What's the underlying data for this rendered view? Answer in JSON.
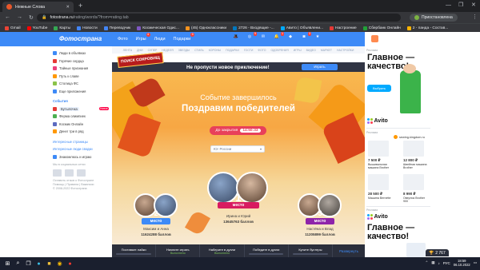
{
  "browser": {
    "tab_title": "Нежные Слова",
    "url_host": "fotostrana.ru",
    "url_path": "/rating/words/?from=rating.tab",
    "incognito_label": "Приостановлена"
  },
  "bookmarks": [
    {
      "label": "Gmail",
      "color": "#ea4335"
    },
    {
      "label": "YouTube",
      "color": "#ff0000"
    },
    {
      "label": "Карты",
      "color": "#34a853"
    },
    {
      "label": "Новости",
      "color": "#4285f4"
    },
    {
      "label": "Переводчик",
      "color": "#4285f4"
    },
    {
      "label": "Космическая Одис...",
      "color": "#7e57c2"
    },
    {
      "label": "(45) Одноклассники",
      "color": "#f7931e"
    },
    {
      "label": "2726 - Входящие -...",
      "color": "#0277bd"
    },
    {
      "label": "Авито | Объявлени...",
      "color": "#00aaff"
    },
    {
      "label": "Настроение",
      "color": "#e53935"
    },
    {
      "label": "Сбербанк Онлайн",
      "color": "#21a038"
    },
    {
      "label": "2 - панда - Состав...",
      "color": "#ffb300"
    }
  ],
  "site": {
    "logo": "Фотострана",
    "nav": [
      {
        "label": "Фото",
        "badge": ""
      },
      {
        "label": "Игры",
        "badge": "4"
      },
      {
        "label": "Люди",
        "badge": ""
      },
      {
        "label": "Подарки",
        "badge": "5"
      }
    ],
    "header_icons": [
      {
        "icon": "hat-icon",
        "badge": ""
      },
      {
        "icon": "coins-icon",
        "badge": "5"
      },
      {
        "icon": "chat-icon",
        "badge": ""
      },
      {
        "icon": "bell-icon",
        "badge": "1"
      },
      {
        "icon": "diamond-icon",
        "badge": ""
      },
      {
        "icon": "camera-icon",
        "badge": "3"
      },
      {
        "icon": "star-icon",
        "badge": ""
      }
    ],
    "user_name": "Юрий",
    "subnav": [
      "ЛЕНТА",
      "ДНИ",
      "СУПЕР",
      "НЕДЕЛЯ",
      "ЗВЕЗДЫ",
      "СТИЛЬ",
      "КОРОНЫ",
      "ПОДАРКИ",
      "ГОСТИ",
      "ФОТО",
      "ОДОБРЕНИЯ",
      "ИГРЫ",
      "ВИДЕО",
      "МАРКЕТ",
      "НАСТРОЙКИ"
    ]
  },
  "sidebar": {
    "items": [
      {
        "label": "Люди в объявках",
        "color": "#3d8af7"
      },
      {
        "label": "Горячие сердца",
        "color": "#e53935"
      },
      {
        "label": "Тайные признания",
        "color": "#ec407a"
      },
      {
        "label": "Путь к славе",
        "color": "#ff9800"
      },
      {
        "label": "Столица ФС",
        "color": "#8bc34a"
      },
      {
        "label": "Еще приложения",
        "color": "#3d8af7"
      }
    ],
    "section_title": "События",
    "events": [
      {
        "label": "Бутылочка",
        "color": "#e53935",
        "badge": "Новое"
      },
      {
        "label": "Ферма олимпиек",
        "color": "#4caf50",
        "badge": ""
      },
      {
        "label": "Космик Онлайн",
        "color": "#5c6bc0",
        "badge": ""
      },
      {
        "label": "Денег три в ряд",
        "color": "#ff9800",
        "badge": ""
      }
    ],
    "links": [
      "Интересные страницы",
      "Интересные люди сводки"
    ],
    "fans_label": "Знакомлюсь и играю",
    "social_label": "Мы в социальных сетях",
    "footer_lines": [
      "Оставить отзыв о Фотостране",
      "Помощь | Правила | Вакансии",
      "© 2008-2022 Фотострана"
    ]
  },
  "banner": {
    "badge_text": "ПОИСК СОКРОВИЩ",
    "text": "Не пропусти новое приключение!",
    "button": "Играть"
  },
  "event": {
    "subtitle": "Событие завершилось",
    "title": "Поздравим победителей",
    "timer_label": "До закрытия",
    "timer_value": "14:50:33",
    "region_select": "Юг России",
    "winners": [
      {
        "place_num": "1",
        "place_word": "место",
        "name": "Ирина и Юрий",
        "points": "13645763 баллов"
      },
      {
        "place_num": "2",
        "place_word": "место",
        "name": "Максим и Анна",
        "points": "11624288 баллов"
      },
      {
        "place_num": "3",
        "place_word": "место",
        "name": "Настёна и Влад",
        "points": "11205899 баллов"
      }
    ]
  },
  "gamebar": {
    "items": [
      {
        "title": "Поставьте лайки",
        "value": ""
      },
      {
        "title": "Начните играть",
        "value": "Выполнено"
      },
      {
        "title": "Наберите в дуэли",
        "value": "Выполнено"
      },
      {
        "title": "Победите в дуэли",
        "value": ""
      },
      {
        "title": "Купите бустеры",
        "value": ""
      }
    ],
    "more": "Развернуть"
  },
  "ads": {
    "label1": "Реклама",
    "headline1": "Главное — качество!",
    "button1": "Выбрать",
    "brand": "Avito",
    "label2": "Реклама",
    "shop_name": "sewing-kingdom.ru",
    "products": [
      {
        "price": "7 500 ₽",
        "desc": "Вышивальная машина Brother"
      },
      {
        "price": "12 800 ₽",
        "desc": "Швейная машина Brother"
      },
      {
        "price": "28 500 ₽",
        "desc": "Машина Bernette"
      },
      {
        "price": "8 990 ₽",
        "desc": "Оверлок Brother 900"
      }
    ],
    "label3": "Реклама",
    "headline3": "Главное — качество!",
    "rating_value": "2 767"
  },
  "taskbar": {
    "lang": "РУС",
    "time": "18:59",
    "date": "06.10.2022"
  }
}
